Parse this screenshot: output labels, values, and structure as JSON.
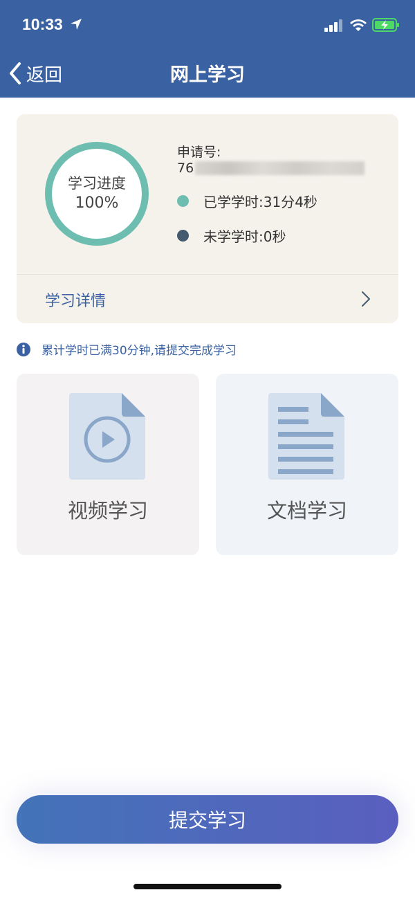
{
  "status_bar": {
    "time": "10:33",
    "icons": [
      "location-arrow-icon",
      "signal-icon",
      "wifi-icon",
      "battery-charging-icon"
    ]
  },
  "header": {
    "back_label": "返回",
    "title": "网上学习"
  },
  "progress_card": {
    "ring_label": "学习进度",
    "ring_value": "100%",
    "progress_fraction": 1.0,
    "application_label": "申请号:",
    "application_number_visible": "76",
    "studied": {
      "label": "已学学时:",
      "value": "31分4秒",
      "color": "#6dbdb0"
    },
    "remaining": {
      "label": "未学学时:",
      "value": "0秒",
      "color": "#445a6e"
    },
    "detail_label": "学习详情"
  },
  "notice": {
    "text": "累计学时已满30分钟,请提交完成学习"
  },
  "tiles": [
    {
      "label": "视频学习",
      "icon": "video-file-icon"
    },
    {
      "label": "文档学习",
      "icon": "document-file-icon"
    }
  ],
  "submit_label": "提交学习",
  "colors": {
    "header_bg": "#3a62a2",
    "accent": "#3a62a2",
    "ring": "#6dbdb0",
    "card_bg": "#f5f2ec"
  }
}
